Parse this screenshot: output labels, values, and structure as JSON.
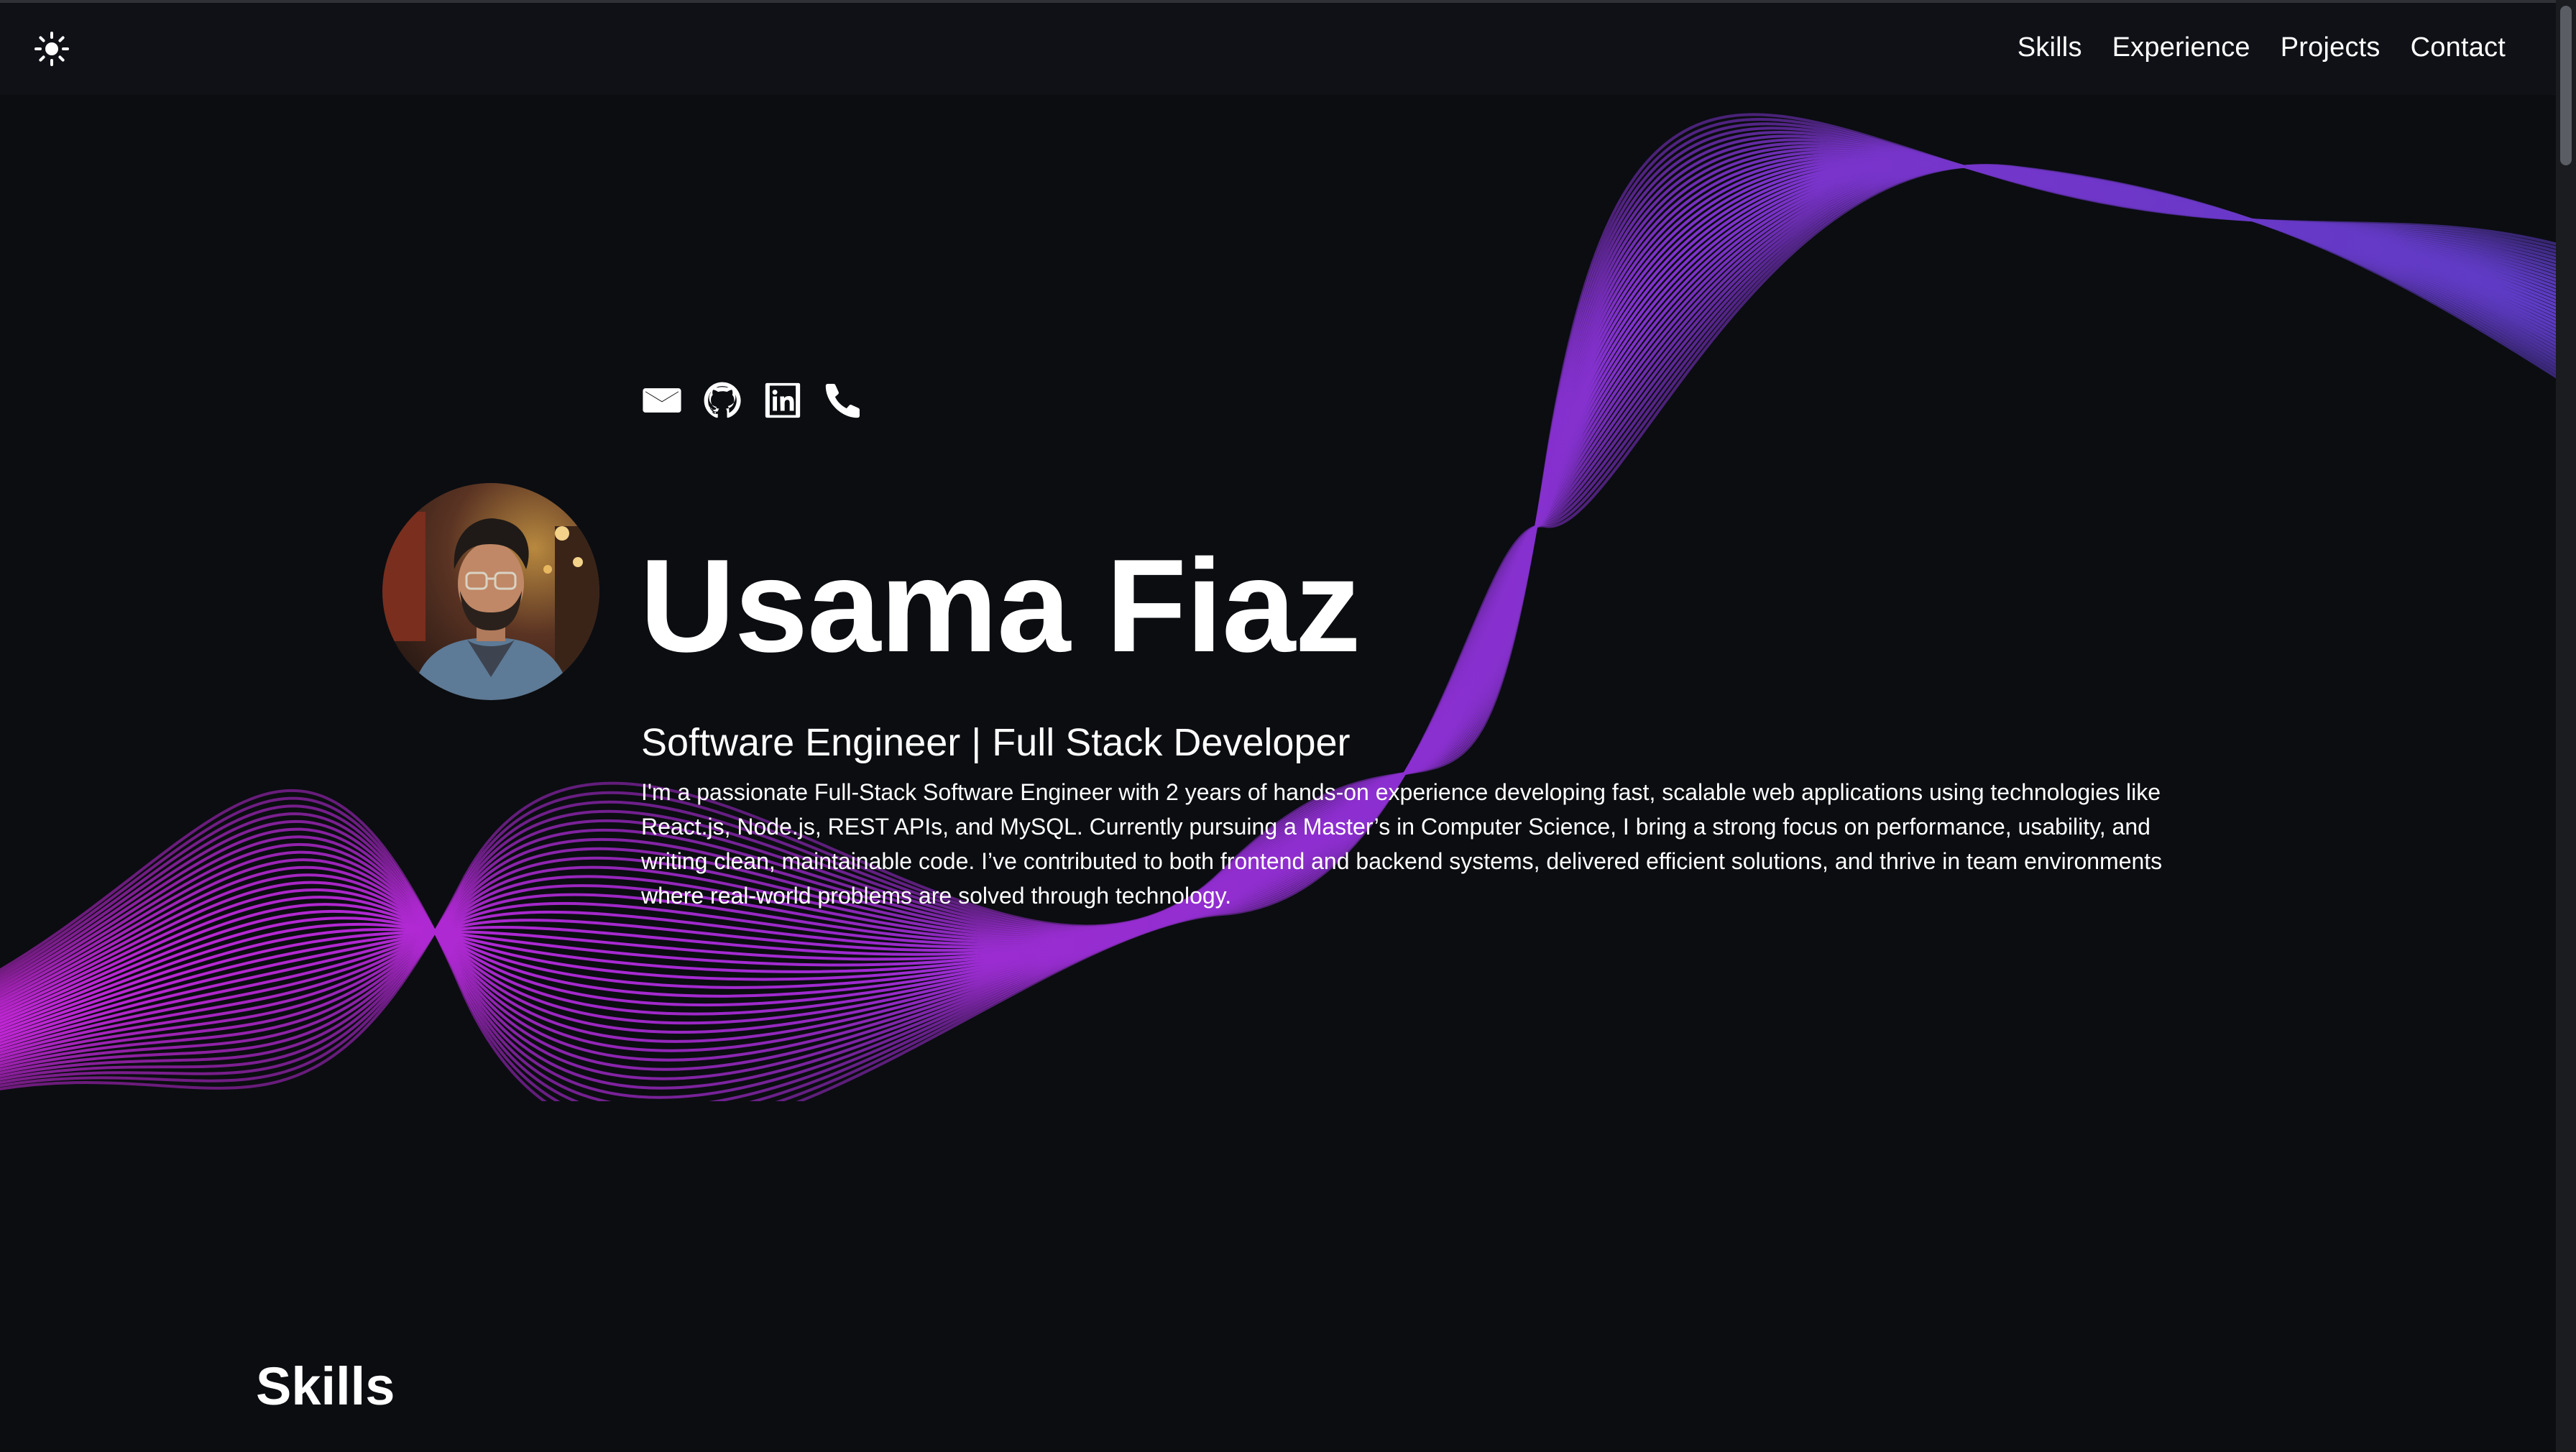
{
  "navbar": {
    "theme_toggle_icon": "sun-icon",
    "links": [
      {
        "label": "Skills"
      },
      {
        "label": "Experience"
      },
      {
        "label": "Projects"
      },
      {
        "label": "Contact"
      }
    ]
  },
  "hero": {
    "social_icons": [
      "mail-icon",
      "github-icon",
      "linkedin-icon",
      "phone-icon"
    ],
    "name": "Usama Fiaz",
    "subtitle": "Software Engineer | Full Stack Developer",
    "bio": "I'm a passionate Full-Stack Software Engineer with 2 years of hands-on experience developing fast, scalable web applications using technologies like React.js, Node.js, REST APIs, and MySQL. Currently pursuing a Master’s in Computer Science, I bring a strong focus on performance, usability, and writing clean, maintainable code. I’ve contributed to both frontend and backend systems, delivered efficient solutions, and thrive in team environments where real-world problems are solved through technology."
  },
  "skills_section": {
    "title": "Skills"
  },
  "colors": {
    "background": "#0b0d11",
    "navbar": "#0f1116",
    "wave_start": "#c026d3",
    "wave_end": "#5b3cc4",
    "text": "#ffffff"
  }
}
